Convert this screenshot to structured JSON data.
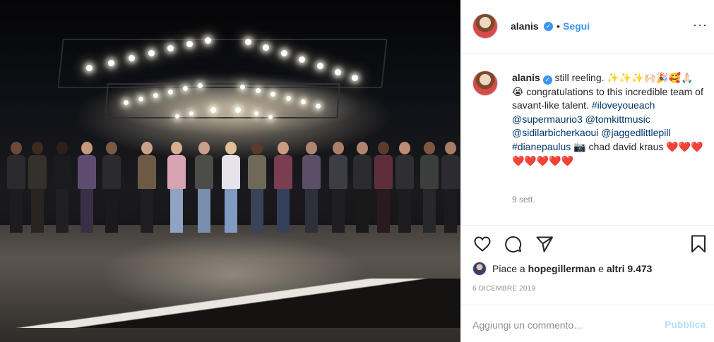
{
  "photo": {
    "alt": ""
  },
  "header": {
    "username": "alanis",
    "verified_icon": "verified-badge-icon",
    "separator": "•",
    "follow_label": "Segui",
    "more_label": "···"
  },
  "post": {
    "username": "alanis",
    "text_intro": " still reeling. ✨✨✨🙌🏻🎉🥰🙏🏻😭 congratulations to this incredible team of savant-like talent. ",
    "hashtag1": "#iloveyoueach",
    "mention1": "@supermaurio3",
    "mention2": "@tomkittmusic",
    "mention3": "@sidilarbicherkaoui",
    "mention4": "@jaggedlittlepill",
    "hashtag2": "#dianepaulus",
    "camera": " 📷 chad david kraus ",
    "hearts": "❤️❤️❤️❤️❤️❤️❤️❤️",
    "time_ago": "9 sett."
  },
  "likes": {
    "prefix": "Piace a ",
    "user": "hopegillerman",
    "middle": " e ",
    "others": "altri 9.473"
  },
  "date": "6 DICEMBRE 2019",
  "comment_box": {
    "placeholder": "Aggiungi un commento...",
    "publish_label": "Pubblica"
  },
  "colors": {
    "link": "#00376b",
    "accent": "#3897f0",
    "muted": "#8e8e8e"
  }
}
